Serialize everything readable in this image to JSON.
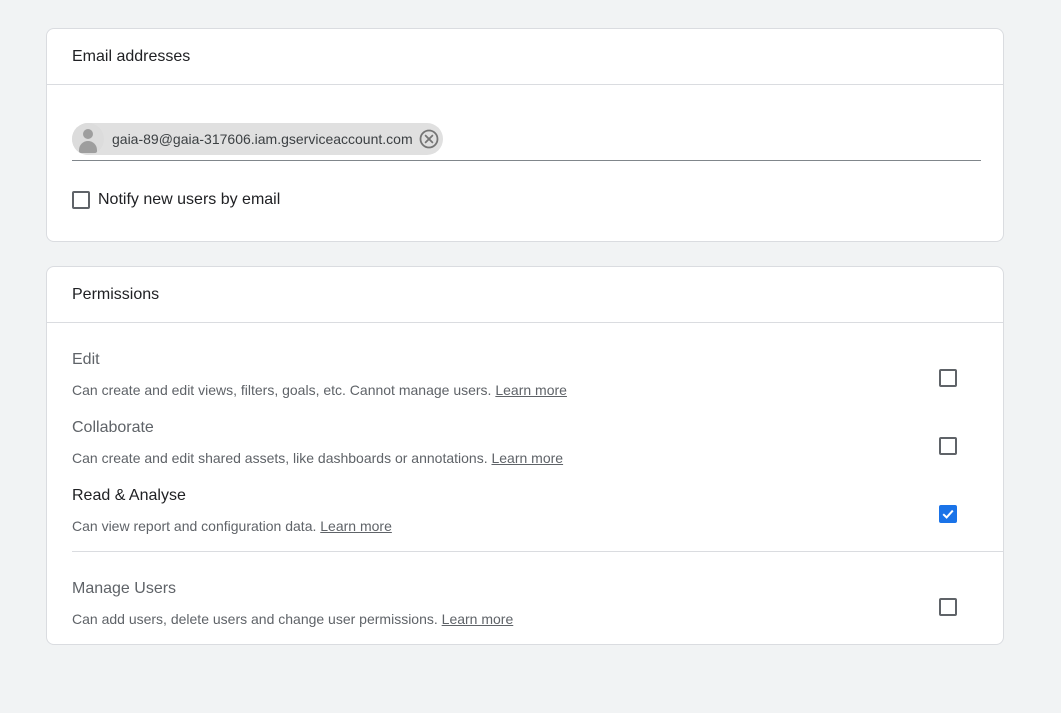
{
  "email_section": {
    "title": "Email addresses",
    "chip": {
      "email": "gaia-89@gaia-317606.iam.gserviceaccount.com",
      "avatar_icon": "person-icon",
      "remove_icon": "close-circle-icon"
    },
    "notify": {
      "label": "Notify new users by email",
      "checked": false
    }
  },
  "permissions_section": {
    "title": "Permissions",
    "items": [
      {
        "title": "Edit",
        "description": "Can create and edit views, filters, goals, etc. Cannot manage users.",
        "link": "Learn more",
        "checked": false
      },
      {
        "title": "Collaborate",
        "description": "Can create and edit shared assets, like dashboards or annotations.",
        "link": "Learn more",
        "checked": false
      },
      {
        "title": "Read & Analyse",
        "description": "Can view report and configuration data.",
        "link": "Learn more",
        "checked": true
      },
      {
        "title": "Manage Users",
        "description": "Can add users, delete users and change user permissions.",
        "link": "Learn more",
        "checked": false
      }
    ]
  },
  "colors": {
    "background": "#f1f3f4",
    "card_border": "#dadce0",
    "accent": "#1a73e8",
    "chip_bg": "#e0e0e0"
  }
}
